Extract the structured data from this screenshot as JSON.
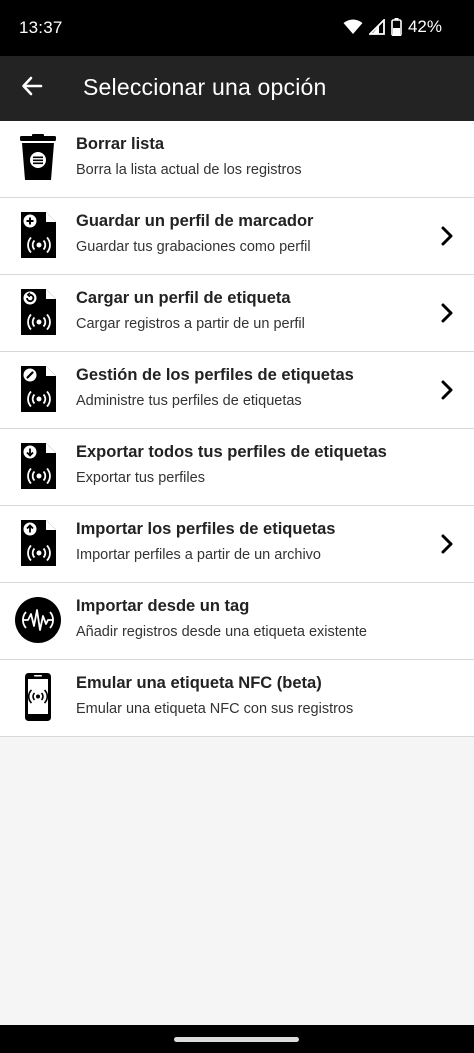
{
  "status_bar": {
    "time": "13:37",
    "battery": "42%",
    "icons": [
      "wifi-icon",
      "cellular-icon",
      "battery-icon"
    ]
  },
  "app_bar": {
    "title": "Seleccionar una opción",
    "back_icon": "arrow-back-icon"
  },
  "menu": {
    "items": [
      {
        "title": "Borrar lista",
        "subtitle": "Borra la lista actual de los registros",
        "icon": "trash-icon",
        "has_chevron": false
      },
      {
        "title": "Guardar un perfil de marcador",
        "subtitle": "Guardar tus grabaciones como perfil",
        "icon": "file-add-nfc-icon",
        "has_chevron": true
      },
      {
        "title": "Cargar un perfil de etiqueta",
        "subtitle": "Cargar registros a partir de un perfil",
        "icon": "file-load-nfc-icon",
        "has_chevron": true
      },
      {
        "title": "Gestión de los perfiles de etiquetas",
        "subtitle": "Administre tus perfiles de etiquetas",
        "icon": "file-edit-nfc-icon",
        "has_chevron": true
      },
      {
        "title": "Exportar todos tus perfiles de etiquetas",
        "subtitle": "Exportar tus perfiles",
        "icon": "file-export-nfc-icon",
        "has_chevron": false
      },
      {
        "title": "Importar los perfiles de etiquetas",
        "subtitle": "Importar perfiles a partir de un archivo",
        "icon": "file-import-nfc-icon",
        "has_chevron": true
      },
      {
        "title": "Importar desde un tag",
        "subtitle": "Añadir registros desde una etiqueta existente",
        "icon": "nfc-tag-icon",
        "has_chevron": false
      },
      {
        "title": "Emular una etiqueta NFC (beta)",
        "subtitle": "Emular una etiqueta NFC con sus registros",
        "icon": "phone-nfc-icon",
        "has_chevron": false
      }
    ]
  },
  "colors": {
    "status_bar": "#000000",
    "app_bar": "#232323",
    "background": "#f5f5f5",
    "divider": "#d8d8d8",
    "text_primary": "#222222"
  }
}
